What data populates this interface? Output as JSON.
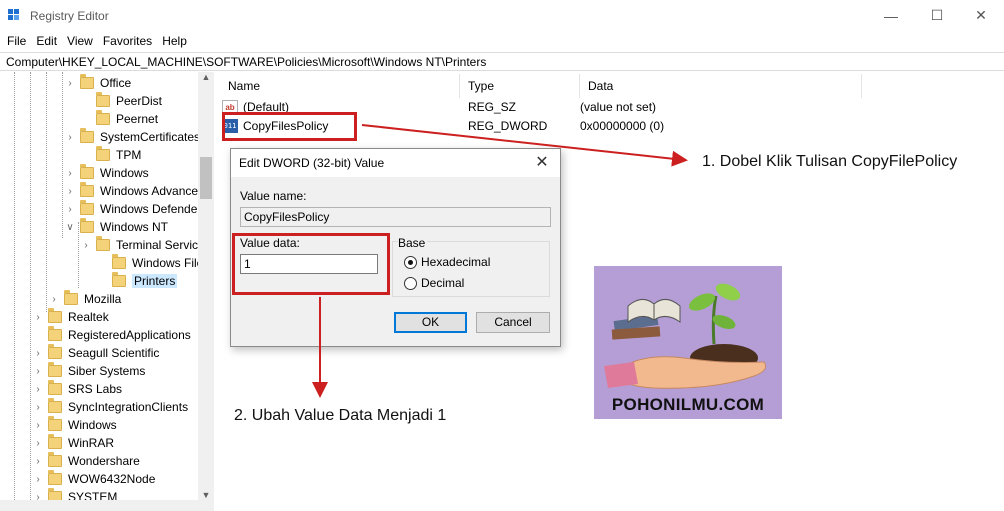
{
  "window": {
    "title": "Registry Editor",
    "minimize_glyph": "—",
    "maximize_glyph": "☐",
    "close_glyph": "✕"
  },
  "menu": [
    "File",
    "Edit",
    "View",
    "Favorites",
    "Help"
  ],
  "address": "Computer\\HKEY_LOCAL_MACHINE\\SOFTWARE\\Policies\\Microsoft\\Windows NT\\Printers",
  "tree": [
    {
      "label": "Office",
      "has_children": true,
      "expanded": false
    },
    {
      "label": "PeerDist",
      "has_children": false,
      "expanded": false
    },
    {
      "label": "Peernet",
      "has_children": false,
      "expanded": false
    },
    {
      "label": "SystemCertificates",
      "has_children": true,
      "expanded": false
    },
    {
      "label": "TPM",
      "has_children": false,
      "expanded": false
    },
    {
      "label": "Windows",
      "has_children": true,
      "expanded": false
    },
    {
      "label": "Windows Advance",
      "has_children": true,
      "expanded": false
    },
    {
      "label": "Windows Defender",
      "has_children": true,
      "expanded": false
    },
    {
      "label": "Windows NT",
      "has_children": true,
      "expanded": true
    },
    {
      "label": "Terminal Service",
      "has_children": true,
      "expanded": false
    },
    {
      "label": "Windows File Pr",
      "has_children": false,
      "expanded": false
    },
    {
      "label": "Printers",
      "has_children": false,
      "expanded": false,
      "selected": true
    },
    {
      "label": "Mozilla",
      "has_children": true,
      "expanded": false
    },
    {
      "label": "Realtek",
      "has_children": true,
      "expanded": false
    },
    {
      "label": "RegisteredApplications",
      "has_children": false,
      "expanded": false
    },
    {
      "label": "Seagull Scientific",
      "has_children": true,
      "expanded": false
    },
    {
      "label": "Siber Systems",
      "has_children": true,
      "expanded": false
    },
    {
      "label": "SRS Labs",
      "has_children": true,
      "expanded": false
    },
    {
      "label": "SyncIntegrationClients",
      "has_children": true,
      "expanded": false
    },
    {
      "label": "Windows",
      "has_children": true,
      "expanded": false
    },
    {
      "label": "WinRAR",
      "has_children": true,
      "expanded": false
    },
    {
      "label": "Wondershare",
      "has_children": true,
      "expanded": false
    },
    {
      "label": "WOW6432Node",
      "has_children": true,
      "expanded": false
    },
    {
      "label": "SYSTEM",
      "has_children": true,
      "expanded": false
    }
  ],
  "list": {
    "columns": [
      "Name",
      "Type",
      "Data"
    ],
    "rows": [
      {
        "name": "(Default)",
        "type": "REG_SZ",
        "data": "(value not set)",
        "icon": "string-value-icon"
      },
      {
        "name": "CopyFilesPolicy",
        "type": "REG_DWORD",
        "data": "0x00000000 (0)",
        "icon": "dword-value-icon"
      }
    ]
  },
  "dialog": {
    "title": "Edit DWORD (32-bit) Value",
    "value_name_label": "Value name:",
    "value_name": "CopyFilesPolicy",
    "value_data_label": "Value data:",
    "value_data": "1",
    "base_label": "Base",
    "hex_label": "Hexadecimal",
    "dec_label": "Decimal",
    "base_selected": "Hexadecimal",
    "ok_label": "OK",
    "cancel_label": "Cancel"
  },
  "annotations": {
    "step1": "1. Dobel Klik Tulisan CopyFilePolicy",
    "step2": "2. Ubah Value Data Menjadi 1",
    "color": "#cc1f1f"
  },
  "logo": {
    "text": "POHONILMU.COM",
    "background": "#b59ed6"
  }
}
